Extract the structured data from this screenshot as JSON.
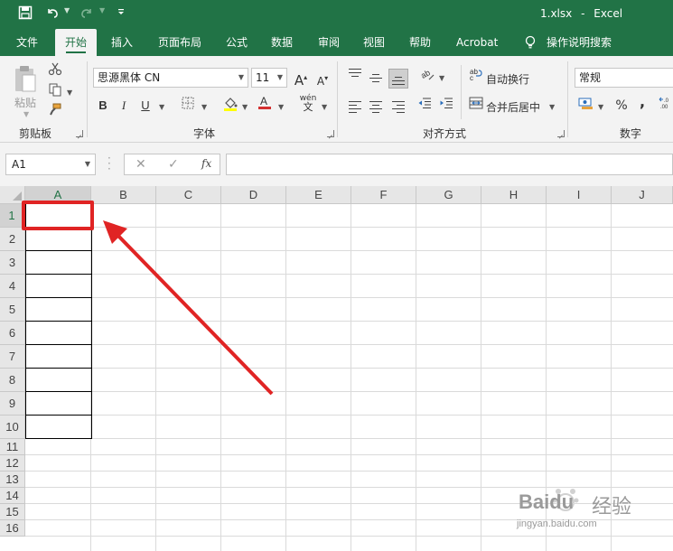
{
  "title_bar": {
    "filename": "1.xlsx",
    "separator": "-",
    "app": "Excel"
  },
  "qat": {
    "save": "save-icon",
    "undo": "undo-icon",
    "redo": "redo-icon",
    "customize": "customize-icon"
  },
  "tabs": [
    "文件",
    "开始",
    "插入",
    "页面布局",
    "公式",
    "数据",
    "审阅",
    "视图",
    "帮助",
    "Acrobat"
  ],
  "active_tab": "开始",
  "tell_me": "操作说明搜索",
  "ribbon": {
    "clipboard": {
      "paste_label": "粘贴",
      "group_label": "剪贴板"
    },
    "font": {
      "font_name": "思源黑体 CN",
      "font_size": "11",
      "group_label": "字体",
      "bold": "B",
      "italic": "I",
      "underline": "U",
      "grow": "A",
      "shrink": "A",
      "phonetic_top": "wén",
      "phonetic_bottom": "文"
    },
    "alignment": {
      "wrap_text": "自动换行",
      "merge_center": "合并后居中",
      "group_label": "对齐方式"
    },
    "number": {
      "format": "常规",
      "percent": "%",
      "comma": ",",
      "group_label": "数字"
    }
  },
  "formula_bar": {
    "name_box": "A1",
    "cancel": "✕",
    "enter": "✓",
    "fx": "fx",
    "formula": ""
  },
  "grid": {
    "columns": [
      "A",
      "B",
      "C",
      "D",
      "E",
      "F",
      "G",
      "H",
      "I",
      "J"
    ],
    "rows": [
      "1",
      "2",
      "3",
      "4",
      "5",
      "6",
      "7",
      "8",
      "9",
      "10",
      "11",
      "12",
      "13",
      "14",
      "15",
      "16"
    ],
    "selected_cell": "A1"
  },
  "watermark": {
    "brand": "Baidu",
    "brand_cn": "经验",
    "url": "jingyan.baidu.com"
  },
  "colors": {
    "excel_green": "#217346",
    "annotation_red": "#e02424"
  }
}
